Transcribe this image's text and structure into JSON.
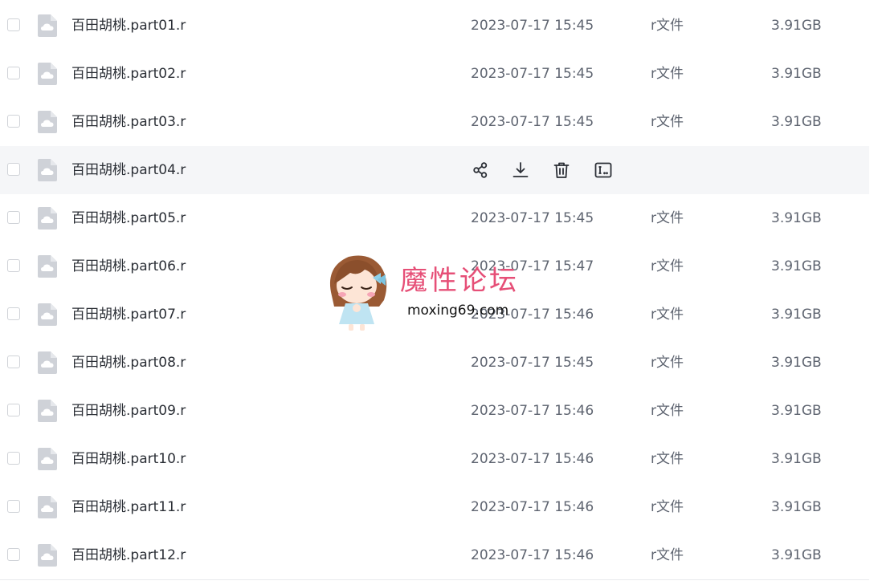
{
  "files": [
    {
      "name": "百田胡桃.part01.r",
      "date": "2023-07-17 15:45",
      "type": "r文件",
      "size": "3.91GB"
    },
    {
      "name": "百田胡桃.part02.r",
      "date": "2023-07-17 15:45",
      "type": "r文件",
      "size": "3.91GB"
    },
    {
      "name": "百田胡桃.part03.r",
      "date": "2023-07-17 15:45",
      "type": "r文件",
      "size": "3.91GB"
    },
    {
      "name": "百田胡桃.part04.r",
      "date": "",
      "type": "",
      "size": "",
      "hovered": true
    },
    {
      "name": "百田胡桃.part05.r",
      "date": "2023-07-17 15:45",
      "type": "r文件",
      "size": "3.91GB"
    },
    {
      "name": "百田胡桃.part06.r",
      "date": "2023-07-17 15:47",
      "type": "r文件",
      "size": "3.91GB"
    },
    {
      "name": "百田胡桃.part07.r",
      "date": "2023-07-17 15:46",
      "type": "r文件",
      "size": "3.91GB"
    },
    {
      "name": "百田胡桃.part08.r",
      "date": "2023-07-17 15:45",
      "type": "r文件",
      "size": "3.91GB"
    },
    {
      "name": "百田胡桃.part09.r",
      "date": "2023-07-17 15:46",
      "type": "r文件",
      "size": "3.91GB"
    },
    {
      "name": "百田胡桃.part10.r",
      "date": "2023-07-17 15:46",
      "type": "r文件",
      "size": "3.91GB"
    },
    {
      "name": "百田胡桃.part11.r",
      "date": "2023-07-17 15:46",
      "type": "r文件",
      "size": "3.91GB"
    },
    {
      "name": "百田胡桃.part12.r",
      "date": "2023-07-17 15:46",
      "type": "r文件",
      "size": "3.91GB"
    }
  ],
  "hover_actions": [
    {
      "icon": "share-icon"
    },
    {
      "icon": "download-icon"
    },
    {
      "icon": "delete-icon"
    },
    {
      "icon": "rename-icon"
    }
  ],
  "watermark": {
    "title": "魔性论坛",
    "url": "moxing69.com"
  },
  "colors": {
    "hover_row": "#f5f6f8",
    "watermark_pink": "#e64f77",
    "secondary_text": "#5e6470",
    "file_icon": "#cfd2d8"
  }
}
